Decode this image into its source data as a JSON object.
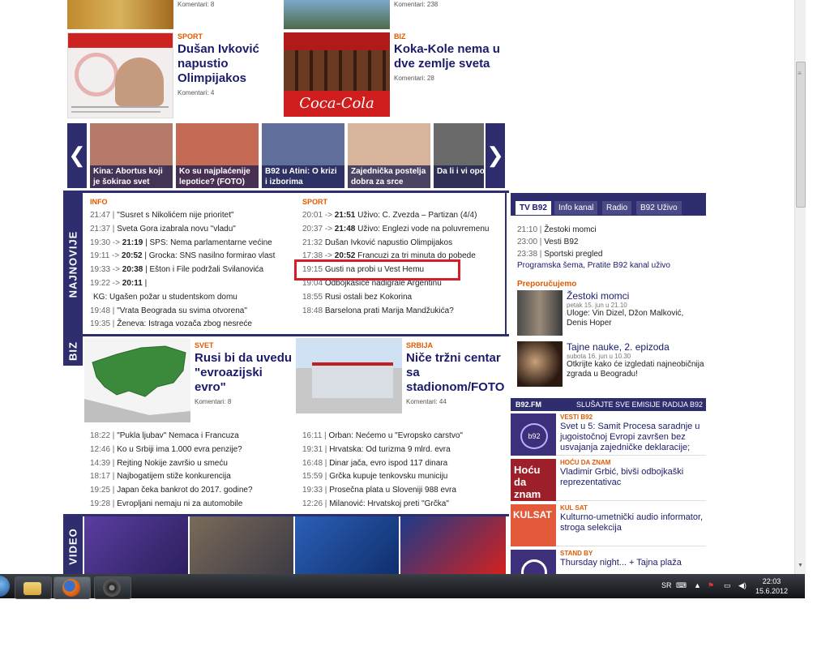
{
  "top_stories": [
    {
      "comments": "Komentari: 8"
    },
    {
      "comments": "Komentari: 238"
    },
    {
      "category": "SPORT",
      "title": "Dušan Ivković napustio Olimpijakos",
      "comments": "Komentari: 4"
    },
    {
      "category": "BIZ",
      "title": "Koka-Kole nema u dve zemlje sveta",
      "comments": "Komentari: 28"
    }
  ],
  "gallery": {
    "prev": "❮",
    "next": "❯",
    "items": [
      {
        "caption": "Kina: Abortus koji je šokirao svet",
        "color": "#b57a6a"
      },
      {
        "caption": "Ko su najplaćenije lepotice? (FOTO)",
        "color": "#c46a55"
      },
      {
        "caption": "B92 u Atini: O krizi i izborima",
        "color": "#5f6e9a"
      },
      {
        "caption": "Zajednička postelja dobra za srce",
        "color": "#d7b49c"
      },
      {
        "caption": "Da li i vi opor saobraćaje",
        "color": "#6a6a6a"
      }
    ]
  },
  "najnovije": {
    "tab": "NAJNOVIJE",
    "info": {
      "label": "INFO",
      "items": [
        {
          "time": "21:47 |",
          "text": "\"Susret s Nikolićem nije prioritet\""
        },
        {
          "time": "21:37 |",
          "text": "Sveta Gora izabrala novu \"vladu\""
        },
        {
          "time": "19:30 -> ",
          "bold": "21:19",
          "text": "| SPS: Nema parlamentarne većine"
        },
        {
          "time": "19:11 -> ",
          "bold": "20:52",
          "text": "| Grocka: SNS nasilno formirao vlast"
        },
        {
          "time": "19:33 -> ",
          "bold": "20:38",
          "text": "| Ešton i File podržali Svilanovića"
        },
        {
          "time": "19:22 -> ",
          "bold": "20:11",
          "text": "|"
        },
        {
          "time": "",
          "text": "KG: Ugašen požar u studentskom domu"
        },
        {
          "time": "19:48 |",
          "text": "\"Vrata Beograda su svima otvorena\""
        },
        {
          "time": "19:35 |",
          "text": "Ženeva: Istraga vozača zbog nesreće"
        }
      ]
    },
    "sport": {
      "label": "SPORT",
      "items": [
        {
          "time": "20:01 -> ",
          "bold": "21:51",
          "text": "Uživo: C. Zvezda – Partizan (4/4)"
        },
        {
          "time": "20:37 -> ",
          "bold": "21:48",
          "text": "Uživo: Englezi vode na poluvremenu"
        },
        {
          "time": "21:32",
          "text": "Dušan Ivković napustio Olimpijakos"
        },
        {
          "time": "17:38 -> ",
          "bold": "20:52",
          "text": "Francuzi za tri minuta do pobede"
        },
        {
          "time": "19:15",
          "text": "Gusti na probi u Vest Hemu"
        },
        {
          "time": "19:04",
          "text": "Odbojkašice nadigrale Argentinu"
        },
        {
          "time": "18:55",
          "text": "Rusi ostali bez Kokorina"
        },
        {
          "time": "18:48",
          "text": "Barselona prati Marija Mandžukića?"
        }
      ]
    }
  },
  "biz": {
    "tab": "BIZ",
    "story1": {
      "category": "SVET",
      "title": "Rusi bi da uvedu \"evroazijski evro\"",
      "comments": "Komentari: 8"
    },
    "story2": {
      "category": "SRBIJA",
      "title": "Niče tržni centar sa stadionom/FOTO",
      "comments": "Komentari: 44"
    },
    "left": [
      {
        "time": "18:22 |",
        "text": "\"Pukla ljubav\" Nemaca i Francuza"
      },
      {
        "time": "12:46 |",
        "text": "Ko u Srbiji ima 1.000 evra penzije?"
      },
      {
        "time": "14:39 |",
        "text": "Rejting Nokije završio u smeću"
      },
      {
        "time": "18:17 |",
        "text": "Najbogatijem stiže konkurencija"
      },
      {
        "time": "19:25 |",
        "text": "Japan čeka bankrot do 2017. godine?"
      },
      {
        "time": "19:28 |",
        "text": "Evropljani nemaju ni za automobile"
      }
    ],
    "right": [
      {
        "time": "16:11 |",
        "text": "Orban: Nećemo u \"Evropsko carstvo\""
      },
      {
        "time": "19:31 |",
        "text": "Hrvatska: Od turizma 9 mlrd. evra"
      },
      {
        "time": "16:48 |",
        "text": "Dinar jača, evro ispod 117 dinara"
      },
      {
        "time": "15:59 |",
        "text": "Grčka kupuje tenkovsku municiju"
      },
      {
        "time": "19:33 |",
        "text": "Prosečna plata u Sloveniji 988 evra"
      },
      {
        "time": "12:26 |",
        "text": "Milanović: Hrvatskoj preti \"Grčka\""
      }
    ]
  },
  "video": {
    "tab": "VIDEO"
  },
  "tv": {
    "tabs": [
      "TV B92",
      "Info kanal",
      "Radio",
      "B92 Uživo"
    ],
    "schedule": [
      {
        "time": "21:10 |",
        "text": "Žestoki momci"
      },
      {
        "time": "23:00 |",
        "text": "Vesti B92"
      },
      {
        "time": "23:38 |",
        "text": "Sportski pregled"
      }
    ],
    "links": "Programska šema, Pratite B92 kanal uživo",
    "recommend_label": "Preporučujemo",
    "recommend": [
      {
        "title": "Žestoki momci",
        "date": "petak 15. jun u 21.10",
        "desc": "Uloge: Vin Dizel, Džon Malković, Denis Hoper"
      },
      {
        "title": "Tajne nauke, 2. epizoda",
        "date": "subota 16. jun u 10.30",
        "desc": "Otkrijte kako će izgledati najneobičnija zgrada u Beogradu!"
      }
    ]
  },
  "fm": {
    "label": "B92.FM",
    "link": "SLUŠAJTE SVE EMISIJE RADIJA B92",
    "items": [
      {
        "category": "VESTI B92",
        "text": "Svet u 5: Samit Procesa saradnje u jugoistočnoj Evropi završen bez usvajanja zajedničke deklaracije;"
      },
      {
        "category": "HOĆU DA ZNAM",
        "text": "Vladimir Grbić, bivši odbojkaški reprezentativac",
        "thumb_text": "Hoću da znam"
      },
      {
        "category": "KUL SAT",
        "text": "Kulturno-umetnički audio informator, stroga selekcija",
        "thumb_text": "KULSAT"
      },
      {
        "category": "STAND BY",
        "text": "Thursday night... + Tajna plaža"
      }
    ]
  },
  "taskbar": {
    "lang": "SR",
    "time": "22:03",
    "date": "15.6.2012"
  }
}
